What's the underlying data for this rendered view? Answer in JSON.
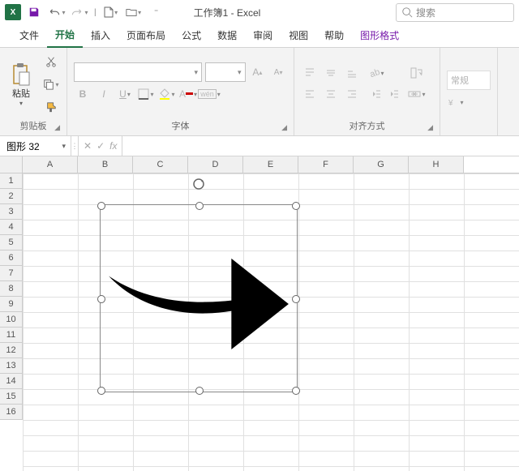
{
  "titlebar": {
    "doc_title": "工作簿1 - Excel",
    "search_placeholder": "搜索"
  },
  "tabs": {
    "file": "文件",
    "home": "开始",
    "insert": "插入",
    "layout": "页面布局",
    "formulas": "公式",
    "data": "数据",
    "review": "审阅",
    "view": "视图",
    "help": "帮助",
    "shape_format": "图形格式"
  },
  "ribbon": {
    "paste": "粘贴",
    "clipboard": "剪贴板",
    "font": "字体",
    "alignment": "对齐方式",
    "general": "常规"
  },
  "name_box": {
    "value": "图形 32"
  },
  "columns": [
    "A",
    "B",
    "C",
    "D",
    "E",
    "F",
    "G",
    "H"
  ],
  "rows": [
    1,
    2,
    3,
    4,
    5,
    6,
    7,
    8,
    9,
    10,
    11,
    12,
    13,
    14,
    15,
    16
  ]
}
